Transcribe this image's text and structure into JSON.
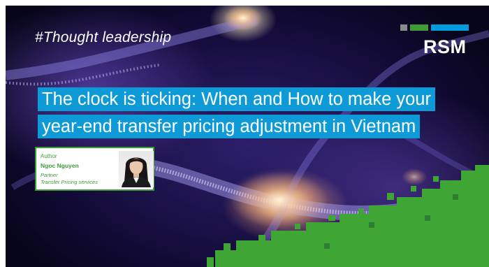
{
  "banner": {
    "hashtag": "#Thought leadership",
    "logo": {
      "text": "RSM",
      "bar_colors": [
        "#888b8d",
        "#3f9c35",
        "#009cde"
      ]
    },
    "title_lines": [
      "The clock is ticking: When and How to make your",
      "year-end transfer pricing adjustment in Vietnam"
    ],
    "author": {
      "label": "Author",
      "name": "Ngoc Nguyen",
      "role": "Partner",
      "department": "Transfer Pricing services"
    },
    "colors": {
      "title_bg": "#0e9ad7",
      "accent_green": "#3fa535",
      "background": "#120a35"
    }
  }
}
